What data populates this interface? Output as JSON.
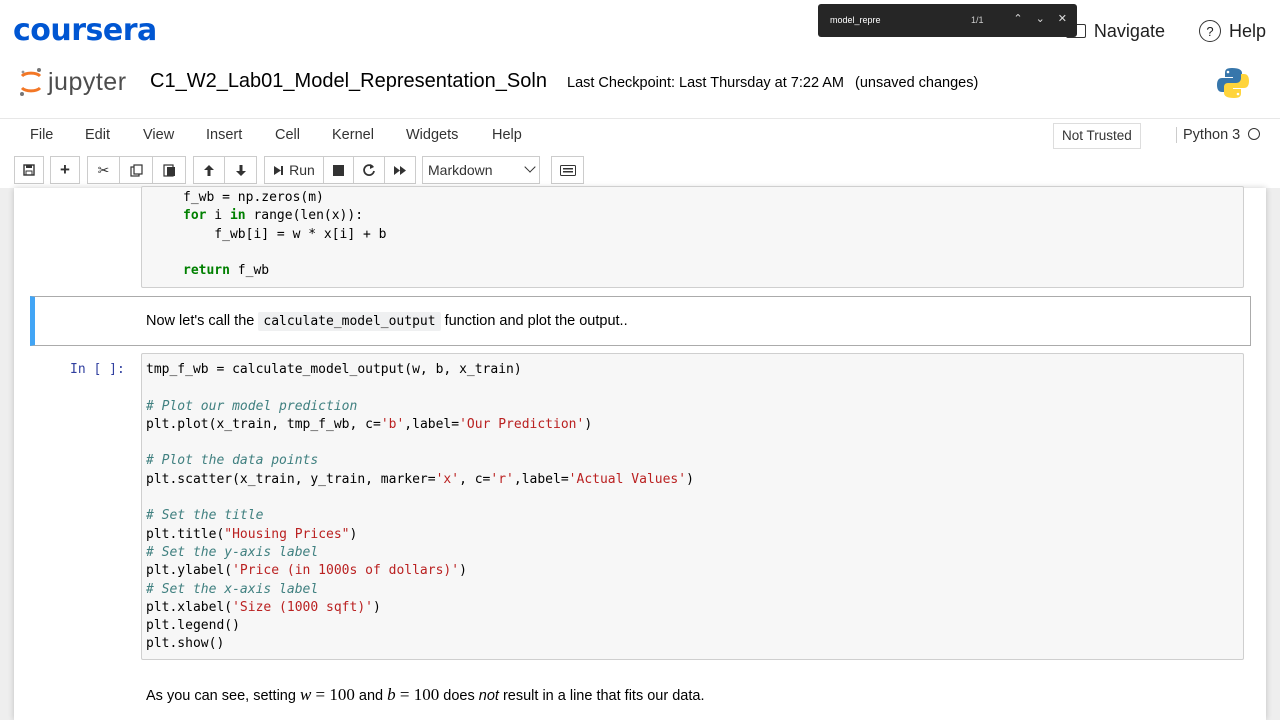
{
  "coursera": {
    "logo": "coursera",
    "navigate": "Navigate",
    "help": "Help"
  },
  "findbar": {
    "query": "model_repre",
    "count": "1/1",
    "up": "⌃",
    "down": "⌄",
    "close": "✕"
  },
  "jupyter": {
    "logo_text": "jupyter",
    "notebook_name": "C1_W2_Lab01_Model_Representation_Soln",
    "checkpoint": "Last Checkpoint: Last Thursday at 7:22 AM",
    "unsaved": "(unsaved changes)"
  },
  "menu": [
    "File",
    "Edit",
    "View",
    "Insert",
    "Cell",
    "Kernel",
    "Widgets",
    "Help"
  ],
  "trust": "Not Trusted",
  "kernel": "Python 3",
  "toolbar": {
    "run": "Run",
    "cell_type": "Markdown"
  },
  "cell1": {
    "line1": "f_wb = np.zeros(m)",
    "line2_kw": "for",
    "line2_rest": " i ",
    "line2_in": "in",
    "line2_end": " range(len(x)):",
    "line3": "    f_wb[i] = w * x[i] + b",
    "line5_kw": "return",
    "line5_rest": " f_wb"
  },
  "md1": {
    "before": "Now let's call the",
    "code": "calculate_model_output",
    "after": "function and plot the output.."
  },
  "cell2": {
    "prompt": "In [ ]:",
    "l1": "tmp_f_wb = calculate_model_output(w, b, x_train)",
    "c1": "# Plot our model prediction",
    "l2a": "plt.plot(x_train, tmp_f_wb, c=",
    "l2s1": "'b'",
    "l2b": ",label=",
    "l2s2": "'Our Prediction'",
    "l2c": ")",
    "c2": "# Plot the data points",
    "l3a": "plt.scatter(x_train, y_train, marker=",
    "l3s1": "'x'",
    "l3b": ", c=",
    "l3s2": "'r'",
    "l3c": ",label=",
    "l3s3": "'Actual Values'",
    "l3d": ")",
    "c3": "# Set the title",
    "l4a": "plt.title(",
    "l4s": "\"Housing Prices\"",
    "l4b": ")",
    "c4": "# Set the y-axis label",
    "l5a": "plt.ylabel(",
    "l5s": "'Price (in 1000s of dollars)'",
    "l5b": ")",
    "c5": "# Set the x-axis label",
    "l6a": "plt.xlabel(",
    "l6s": "'Size (1000 sqft)'",
    "l6b": ")",
    "l7": "plt.legend()",
    "l8": "plt.show()"
  },
  "md2": {
    "t1": "As you can see, setting",
    "w": "w",
    "eq1": " = 100",
    "t2": "and",
    "b": "b",
    "eq2": " = 100",
    "t3": "does",
    "not": "not",
    "t4": "result in a line that fits our data."
  }
}
